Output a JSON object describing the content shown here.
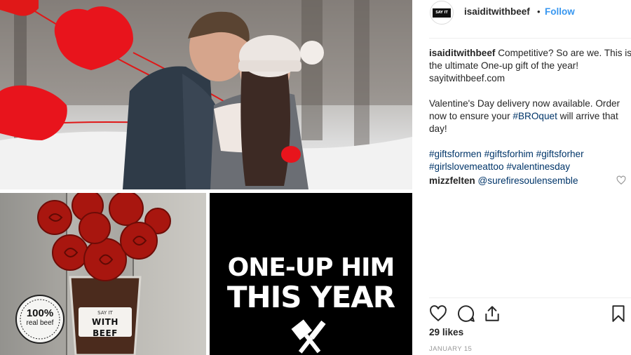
{
  "post": {
    "header": {
      "avatar_text": "SAY IT WITH BEEF",
      "username": "isaiditwithbeef",
      "separator": "•",
      "follow_label": "Follow"
    },
    "caption": {
      "username": "isaiditwithbeef",
      "line1": "Competitive? So are we. This is the ultimate One-up gift of the year! sayitwithbeef.com",
      "line2_prefix": "Valentine's Day delivery now available. Order now to ensure your ",
      "line2_tag": "#BROquet",
      "line2_suffix": " will arrive that day!",
      "hashtags": [
        "#giftsformen",
        "#giftsforhim",
        "#giftsforher",
        "#girlslovemeattoo",
        "#valentinesday"
      ]
    },
    "comment": {
      "username": "mizzfelten",
      "mention": "@surefiresoulensemble"
    },
    "likes_text": "29 likes",
    "date_text": "JANUARY 15"
  },
  "media": {
    "promo_line1": "ONE-UP HIM",
    "promo_line2": "THIS YEAR",
    "badge_number": "100%",
    "badge_label": "real beef",
    "cup_label_top": "SAY IT",
    "cup_label_bottom": "WITH BEEF"
  },
  "icons": {
    "like": "heart-outline-icon",
    "comment": "speech-bubble-icon",
    "share": "share-upload-icon",
    "save": "bookmark-icon",
    "comment_like": "small-heart-icon"
  },
  "colors": {
    "follow_blue": "#3897f0",
    "tag_navy": "#003569",
    "balloon_red": "#e01818",
    "promo_bg": "#000000"
  }
}
